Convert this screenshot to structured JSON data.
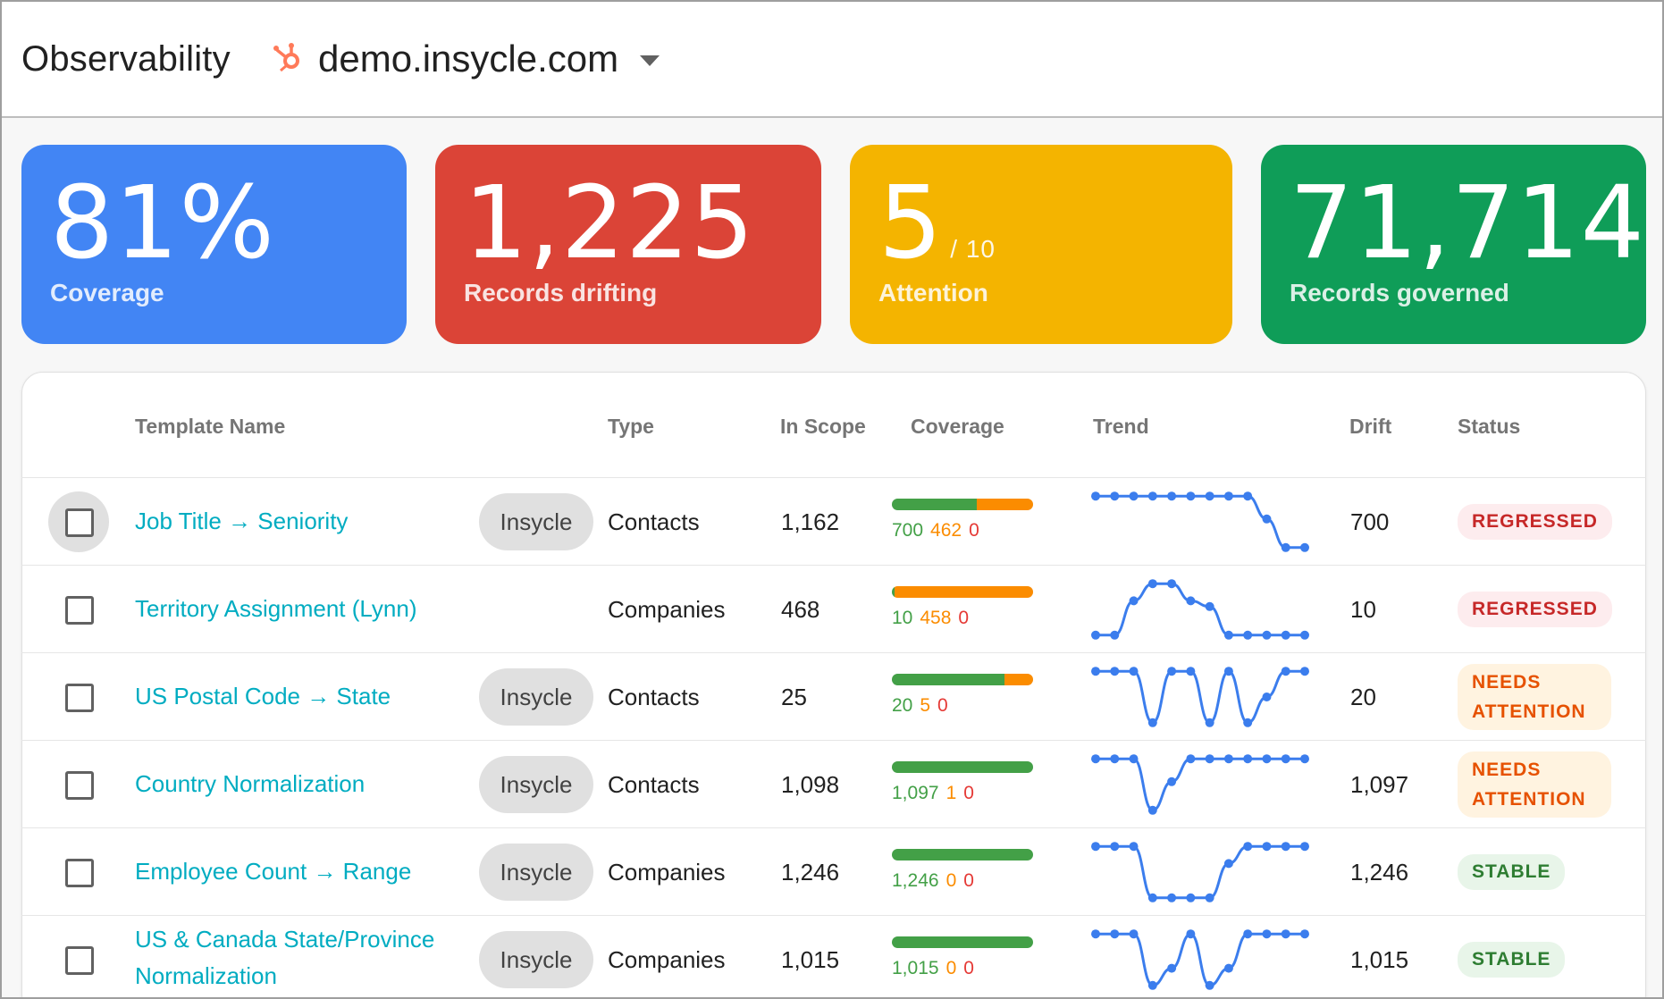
{
  "header": {
    "app_title": "Observability",
    "portal_icon": "hubspot-sprocket-icon",
    "portal_name": "demo.insycle.com",
    "dropdown_icon": "caret-down-icon"
  },
  "kpis": {
    "coverage": {
      "value": "81%",
      "label": "Coverage",
      "color": "#4285f4"
    },
    "drifting": {
      "value": "1,225",
      "label": "Records drifting",
      "color": "#db4437"
    },
    "attention": {
      "value": "5",
      "suffix": "/ 10",
      "label": "Attention",
      "color": "#f4b400"
    },
    "governed": {
      "value": "71,714",
      "label": "Records governed",
      "color": "#0f9d58"
    }
  },
  "table": {
    "columns": {
      "name": "Template Name",
      "type": "Type",
      "in_scope": "In Scope",
      "coverage": "Coverage",
      "trend": "Trend",
      "drift": "Drift",
      "status": "Status"
    },
    "rows": [
      {
        "name": "Job Title → Seniority",
        "chip": "Insycle",
        "type": "Contacts",
        "in_scope": "1,162",
        "cov_green": "700",
        "cov_orange": "462",
        "cov_red": "0",
        "drift": "700",
        "status": "REGRESSED",
        "status_kind": "regressed",
        "trend": [
          0.05,
          0.05,
          0.05,
          0.05,
          0.05,
          0.05,
          0.05,
          0.05,
          0.05,
          0.45,
          0.95,
          0.95
        ]
      },
      {
        "name": "Territory Assignment (Lynn)",
        "chip": "",
        "type": "Companies",
        "in_scope": "468",
        "cov_green": "10",
        "cov_orange": "458",
        "cov_red": "0",
        "drift": "10",
        "status": "REGRESSED",
        "status_kind": "regressed",
        "trend": [
          0.95,
          0.95,
          0.35,
          0.05,
          0.05,
          0.35,
          0.45,
          0.95,
          0.95,
          0.95,
          0.95,
          0.95
        ]
      },
      {
        "name": "US Postal Code → State",
        "chip": "Insycle",
        "type": "Contacts",
        "in_scope": "25",
        "cov_green": "20",
        "cov_orange": "5",
        "cov_red": "0",
        "drift": "20",
        "status": "NEEDS ATTENTION",
        "status_kind": "attention",
        "trend": [
          0.05,
          0.05,
          0.05,
          0.95,
          0.05,
          0.05,
          0.95,
          0.05,
          0.95,
          0.5,
          0.05,
          0.05
        ]
      },
      {
        "name": "Country Normalization",
        "chip": "Insycle",
        "type": "Contacts",
        "in_scope": "1,098",
        "cov_green": "1,097",
        "cov_orange": "1",
        "cov_red": "0",
        "drift": "1,097",
        "status": "NEEDS ATTENTION",
        "status_kind": "attention",
        "trend": [
          0.05,
          0.05,
          0.05,
          0.95,
          0.45,
          0.05,
          0.05,
          0.05,
          0.05,
          0.05,
          0.05,
          0.05
        ]
      },
      {
        "name": "Employee Count → Range",
        "chip": "Insycle",
        "type": "Companies",
        "in_scope": "1,246",
        "cov_green": "1,246",
        "cov_orange": "0",
        "cov_red": "0",
        "drift": "1,246",
        "status": "STABLE",
        "status_kind": "stable",
        "trend": [
          0.05,
          0.05,
          0.05,
          0.95,
          0.95,
          0.95,
          0.95,
          0.35,
          0.05,
          0.05,
          0.05,
          0.05
        ]
      },
      {
        "name": "US & Canada State/Province Normalization",
        "name_line1": "US & Canada State/Province",
        "name_line2": "Normalization",
        "chip": "Insycle",
        "type": "Companies",
        "in_scope": "1,015",
        "cov_green": "1,015",
        "cov_orange": "0",
        "cov_red": "0",
        "drift": "1,015",
        "status": "STABLE",
        "status_kind": "stable",
        "trend": [
          0.05,
          0.05,
          0.05,
          0.95,
          0.65,
          0.05,
          0.95,
          0.65,
          0.05,
          0.05,
          0.05,
          0.05
        ]
      }
    ]
  },
  "colors": {
    "link": "#00acc1",
    "bar_green": "#43a047",
    "bar_orange": "#fb8c00",
    "bar_red": "#e53935",
    "trend_line": "#3b7ded"
  }
}
